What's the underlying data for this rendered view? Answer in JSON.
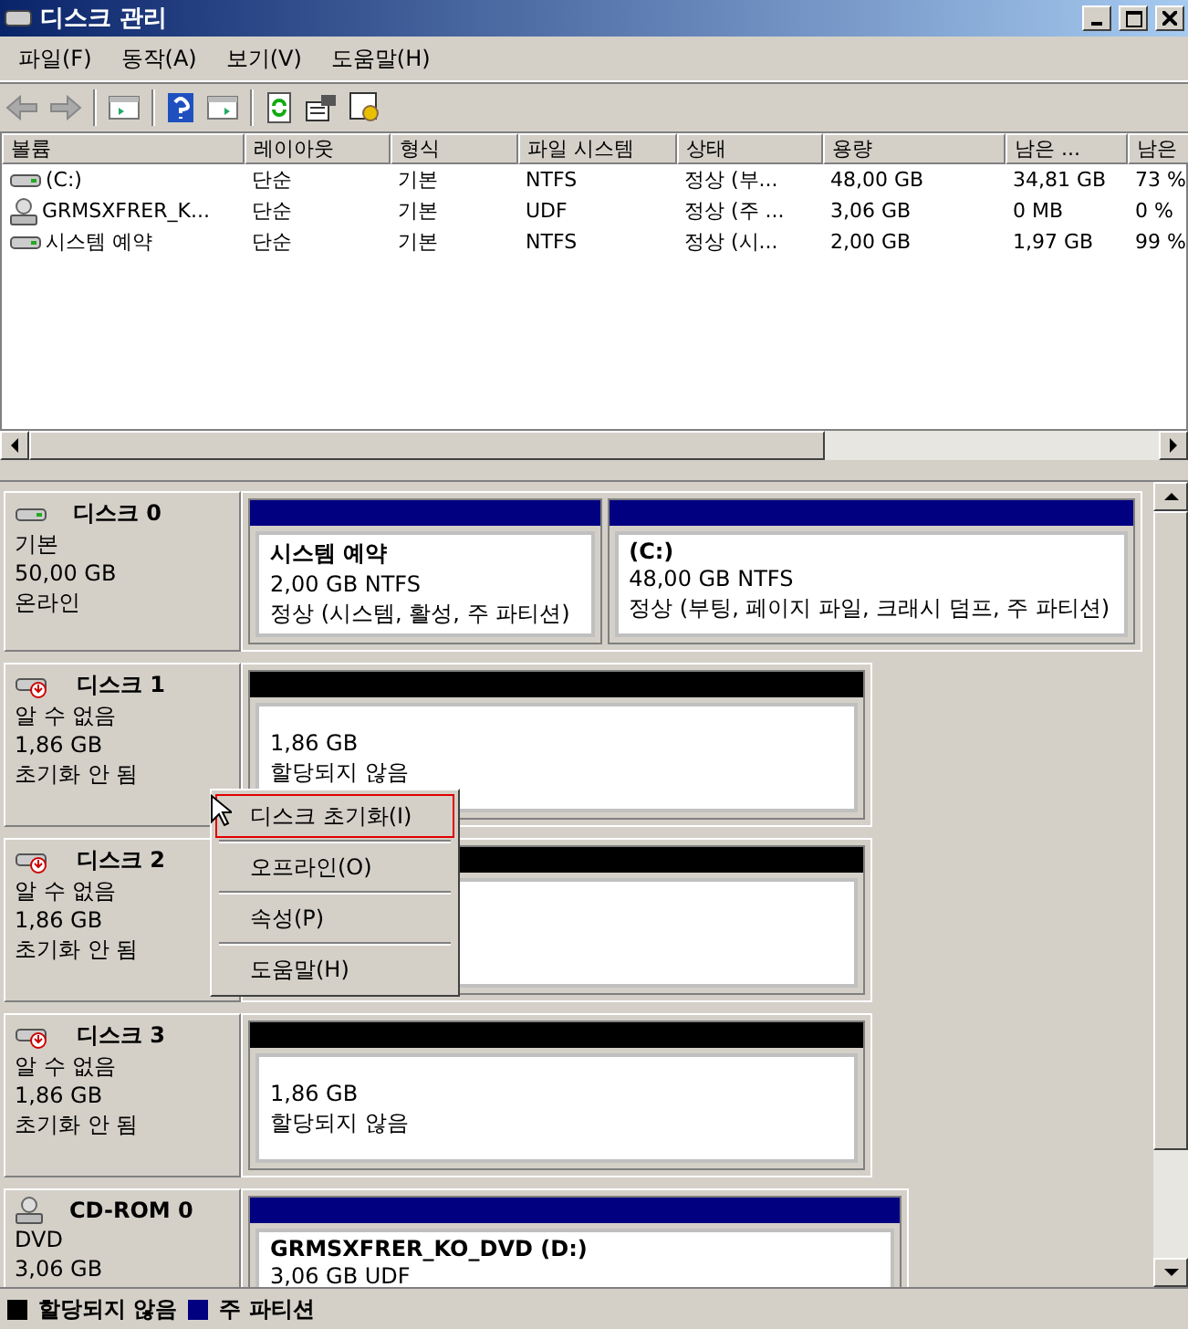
{
  "window": {
    "title": "디스크 관리"
  },
  "menu": [
    "파일(F)",
    "동작(A)",
    "보기(V)",
    "도움말(H)"
  ],
  "volumes": {
    "columns": [
      "볼륨",
      "레이아웃",
      "형식",
      "파일 시스템",
      "상태",
      "용량",
      "남은 ...",
      "남은"
    ],
    "rows": [
      {
        "kind": "disk",
        "cells": [
          "(C:)",
          "단순",
          "기본",
          "NTFS",
          "정상 (부...",
          "48,00 GB",
          "34,81 GB",
          "73 %"
        ]
      },
      {
        "kind": "cdrom",
        "cells": [
          "GRMSXFRER_K...",
          "단순",
          "기본",
          "UDF",
          "정상 (주 ...",
          "3,06 GB",
          "0 MB",
          "0 %"
        ]
      },
      {
        "kind": "disk",
        "cells": [
          "시스템 예약",
          "단순",
          "기본",
          "NTFS",
          "정상 (시...",
          "2,00 GB",
          "1,97 GB",
          "99 %"
        ]
      }
    ]
  },
  "disks": [
    {
      "kind": "basic",
      "name": "디스크 0",
      "lines": [
        "기본",
        "50,00 GB",
        "온라인"
      ],
      "partitions": [
        {
          "color": "#000080",
          "title": "시스템 예약",
          "lines": [
            "2,00 GB NTFS",
            "정상 (시스템, 활성, 주 파티션)"
          ]
        },
        {
          "color": "#000080",
          "title": "(C:)",
          "lines": [
            "48,00 GB NTFS",
            "정상 (부팅, 페이지 파일, 크래시 덤프, 주 파티션)"
          ]
        }
      ]
    },
    {
      "kind": "uninitialized",
      "name": "디스크 1",
      "lines": [
        "알 수 없음",
        "1,86 GB",
        "초기화 안 됨"
      ],
      "partitions": [
        {
          "color": "#000000",
          "lines": [
            "1,86 GB",
            "할당되지 않음"
          ]
        }
      ]
    },
    {
      "kind": "uninitialized",
      "name": "디스크 2",
      "lines": [
        "알 수 없음",
        "1,86 GB",
        "초기화 안 됨"
      ],
      "partitions": [
        {
          "color": "#000000"
        }
      ]
    },
    {
      "kind": "uninitialized",
      "name": "디스크 3",
      "lines": [
        "알 수 없음",
        "1,86 GB",
        "초기화 안 됨"
      ],
      "partitions": [
        {
          "color": "#000000",
          "lines": [
            "1,86 GB",
            "할당되지 않음"
          ]
        }
      ]
    },
    {
      "kind": "cdrom",
      "name": "CD-ROM 0",
      "lines": [
        "DVD",
        "3,06 GB"
      ],
      "partitions": [
        {
          "color": "#000080",
          "title": "GRMSXFRER_KO_DVD  (D:)",
          "lines": [
            "3,06 GB UDF"
          ]
        }
      ]
    }
  ],
  "context_menu": [
    {
      "label": "디스크 초기화(I)",
      "selected": true
    },
    {
      "label": "오프라인(O)",
      "selected": false
    },
    {
      "label": "속성(P)",
      "selected": false
    },
    {
      "label": "도움말(H)",
      "selected": false
    }
  ],
  "legend": [
    {
      "label": "할당되지 않음",
      "color": "#000000"
    },
    {
      "label": "주 파티션",
      "color": "#000080"
    }
  ]
}
